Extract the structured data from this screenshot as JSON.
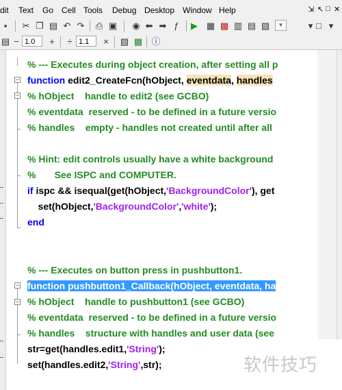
{
  "menu": {
    "items": [
      "dit",
      "Text",
      "Go",
      "Cell",
      "Tools",
      "Debug",
      "Desktop",
      "Window",
      "Help"
    ],
    "window_controls": [
      "⇲",
      "↖",
      "□",
      "✕"
    ]
  },
  "toolbar2": {
    "minus": "−",
    "value1": "1.0",
    "plus": "+",
    "divide": "÷",
    "value2": "1.1",
    "times": "×"
  },
  "code": {
    "l1": "% --- Executes during object creation, after setting all p",
    "l2_kw": "function",
    "l2_a": " edit2_CreateFcn(hObject, ",
    "l2_b": "eventdata",
    "l2_c": ", ",
    "l2_d": "handles",
    "l3": "% hObject    handle to edit2 (see GCBO)",
    "l4": "% eventdata  reserved - to be defined in a future versio",
    "l5": "% handles    empty - handles not created until after all",
    "l6": "% Hint: edit controls usually have a white background",
    "l7": "%       See ISPC and COMPUTER.",
    "l8_kw": "if",
    "l8_a": " ispc && isequal(get(hObject,",
    "l8_s": "'BackgroundColor'",
    "l8_b": "), get",
    "l9_a": "    set(hObject,",
    "l9_s1": "'BackgroundColor'",
    "l9_b": ",",
    "l9_s2": "'white'",
    "l9_c": ");",
    "l10_kw": "end",
    "l11": "% --- Executes on button press in pushbutton1.",
    "l12": "function pushbutton1_Callback(hObject, eventdata, ha",
    "l13": "% hObject    handle to pushbutton1 (see GCBO)",
    "l14": "% eventdata  reserved - to be defined in a future versio",
    "l15": "% handles    structure with handles and user data (see",
    "l16_a": "str=get(handles.edit1,",
    "l16_s": "'String'",
    "l16_b": ");",
    "l17_a": "set(handles.edit2,",
    "l17_s": "'String'",
    "l17_b": ",str);"
  },
  "watermark": "软件技巧",
  "colors": {
    "comment": "#228B22",
    "keyword": "#0000ff",
    "string": "#a020f0",
    "selection": "#3399ff",
    "highlight": "#f5e3b3"
  }
}
